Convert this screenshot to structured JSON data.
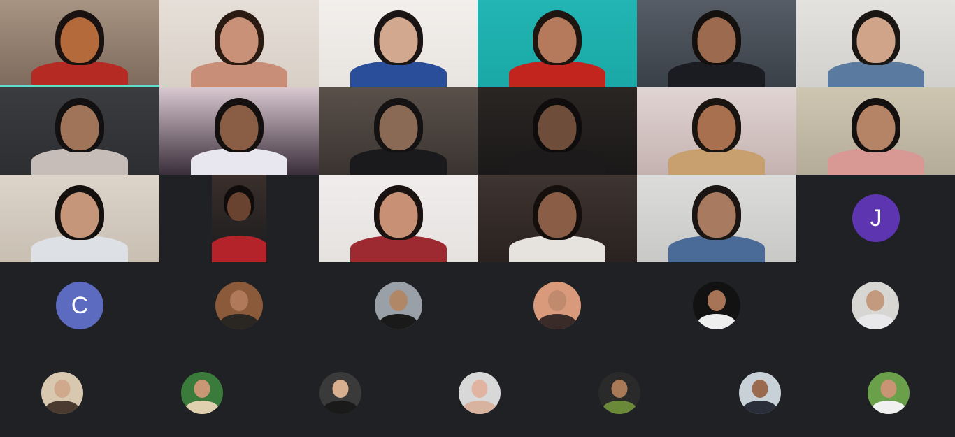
{
  "meeting": {
    "camera_tiles": [
      {
        "bg": "#7e6a5c",
        "wall": "#a89482",
        "skin": "#b56a3c",
        "hair": "#1a1210",
        "shirt": "#b52b24",
        "active": true
      },
      {
        "bg": "#d8cfc6",
        "wall": "#e6dfd8",
        "skin": "#c99278",
        "hair": "#2a1a12",
        "shirt": "#c98e78",
        "active": false
      },
      {
        "bg": "#e8e4e0",
        "wall": "#f2efec",
        "skin": "#d2a98e",
        "hair": "#1a1414",
        "shirt": "#2a4e9a",
        "active": false
      },
      {
        "bg": "#1aa8a6",
        "wall": "#22b5b3",
        "skin": "#b57a5c",
        "hair": "#1e1410",
        "shirt": "#c2251e",
        "active": false
      },
      {
        "bg": "#3a4048",
        "wall": "#565d66",
        "skin": "#9c6a4e",
        "hair": "#14100e",
        "shirt": "#1a1c22",
        "active": false
      },
      {
        "bg": "#d2d0cc",
        "wall": "#e4e2de",
        "skin": "#d0a488",
        "hair": "#1a1614",
        "shirt": "#5a7aa0",
        "active": false
      },
      {
        "bg": "#2c2e32",
        "wall": "#3a3c40",
        "skin": "#a07458",
        "hair": "#121010",
        "shirt": "#c6bcb8",
        "active": false
      },
      {
        "bg": "#3a2e3a",
        "wall": "#d9c8d0",
        "skin": "#8a5e44",
        "hair": "#141010",
        "shirt": "#e8e6ee",
        "active": false
      },
      {
        "bg": "#3a3430",
        "wall": "#5a504a",
        "skin": "#8a6a54",
        "hair": "#141212",
        "shirt": "#1a1a1c",
        "active": false
      },
      {
        "bg": "#1a1818",
        "wall": "#2a2624",
        "skin": "#6e4e3a",
        "hair": "#0e0c0c",
        "shirt": "#1c1a1a",
        "active": false
      },
      {
        "bg": "#c4b2b0",
        "wall": "#e0d4d2",
        "skin": "#a8704e",
        "hair": "#1a1410",
        "shirt": "#c8a070",
        "active": false
      },
      {
        "bg": "#b4ac98",
        "wall": "#cfc6b2",
        "skin": "#b58466",
        "hair": "#141010",
        "shirt": "#d89894",
        "active": false
      },
      {
        "bg": "#c8beb2",
        "wall": "#ddd4ca",
        "skin": "#c6967a",
        "hair": "#14100e",
        "shirt": "#dde0e4",
        "active": false
      },
      {
        "bg": "#1a1c1e",
        "wall": "#3a2e2a",
        "skin": "#6a4230",
        "hair": "#100c0c",
        "shirt": "#b4232a",
        "active": false
      },
      {
        "bg": "#e6e2e0",
        "wall": "#f0ecec",
        "skin": "#c89074",
        "hair": "#1a1210",
        "shirt": "#9c2a30",
        "active": false
      },
      {
        "bg": "#2a2220",
        "wall": "#3e3430",
        "skin": "#8a5e46",
        "hair": "#140e0c",
        "shirt": "#e6e2de",
        "active": false
      },
      {
        "bg": "#c8c8c6",
        "wall": "#dcdcda",
        "skin": "#a87a60",
        "hair": "#1a1412",
        "shirt": "#4a6a98",
        "active": false
      }
    ],
    "letter_avatars": [
      {
        "letter": "J",
        "color": "#5e35b1"
      },
      {
        "letter": "C",
        "color": "#5c6bc0"
      }
    ],
    "photo_avatars": [
      {
        "bg": "#8a5a3a",
        "skin": "#b07a5a",
        "shirt": "#2a2622"
      },
      {
        "bg": "#9aa0a8",
        "skin": "#b08868",
        "shirt": "#1a1a1a"
      },
      {
        "bg": "#d89a7a",
        "skin": "#c08a6e",
        "shirt": "#3a2a28"
      },
      {
        "bg": "#121212",
        "skin": "#a87458",
        "shirt": "#eeeeee"
      },
      {
        "bg": "#d8d6d2",
        "skin": "#c49a7e",
        "shirt": "#e8e8ea"
      },
      {
        "bg": "#d8c8b0",
        "skin": "#d0a88c",
        "shirt": "#4a3a30"
      },
      {
        "bg": "#3a7a3a",
        "skin": "#c89874",
        "shirt": "#e0d0b0"
      },
      {
        "bg": "#3a3a3a",
        "skin": "#d8b090",
        "shirt": "#1a1a1a"
      },
      {
        "bg": "#d8d8d8",
        "skin": "#e0b4a0",
        "shirt": "#d8b4a0"
      },
      {
        "bg": "#2a2a2a",
        "skin": "#a87a58",
        "shirt": "#6a8a3a"
      },
      {
        "bg": "#c8d0d8",
        "skin": "#9a6a4e",
        "shirt": "#2a2e3a"
      },
      {
        "bg": "#6aa04a",
        "skin": "#c89474",
        "shirt": "#f0f0f0"
      }
    ]
  }
}
